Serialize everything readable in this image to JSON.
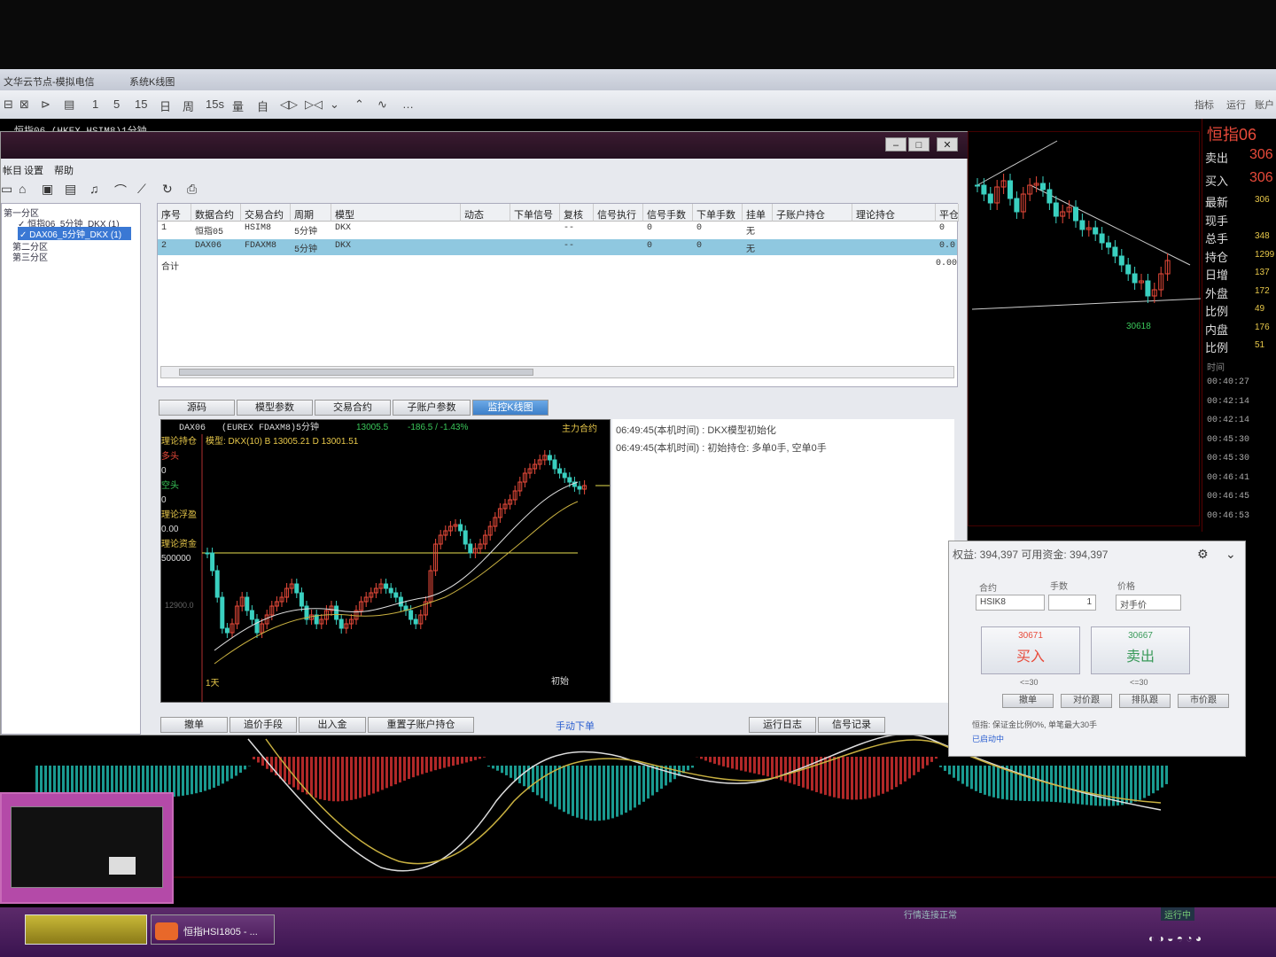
{
  "app": {
    "title": "文华云节点-模拟电信",
    "title2": "系统K线图",
    "toolbar": [
      "1",
      "5",
      "15",
      "日",
      "周",
      "15s",
      "量",
      "自"
    ],
    "toolbar_right": [
      "指标",
      "运行",
      "账户"
    ]
  },
  "main_chart": {
    "header": "恒指06   (HKEX HSIM8)1分钟"
  },
  "strategy_window": {
    "menu": [
      "帐目",
      "设置",
      "帮助"
    ],
    "tree": {
      "group1": "第一分区",
      "item1": "✓ 恒指06_5分钟_DKX (1)",
      "item2": "✓ DAX06_5分钟_DKX (1)",
      "group2": "第二分区",
      "group3": "第三分区"
    },
    "grid": {
      "headers": [
        "序号",
        "数据合约",
        "交易合约",
        "周期",
        "模型",
        "动态",
        "下单信号",
        "复核",
        "信号执行",
        "信号手数",
        "下单手数",
        "挂单",
        "子账户持仓",
        "理论持仓",
        "平仓"
      ],
      "rows": [
        [
          "1",
          "恒指05",
          "HSIM8",
          "5分钟",
          "DKX",
          "--",
          "0",
          "0",
          "无",
          "0"
        ],
        [
          "2",
          "DAX06",
          "FDAXM8",
          "5分钟",
          "DKX",
          "--",
          "0",
          "0",
          "无",
          "0.0"
        ]
      ],
      "total_label": "合计",
      "total_value": "0.00"
    },
    "tabs": [
      "源码",
      "模型参数",
      "交易合约",
      "子账户参数",
      "监控K线图"
    ],
    "mini_chart": {
      "symbol": "DAX06",
      "contract": "(EUREX FDAXM8)5分钟",
      "price": "13005.5",
      "change": "-186.5 / -1.43%",
      "main_label": "主力合约",
      "model_line": "模型: DKX(10)  B 13005.21   D 13001.51",
      "side_labels": [
        "理论持仓",
        "多头",
        "0",
        "空头",
        "0",
        "理论浮盈",
        "0.00",
        "理论资金",
        "500000"
      ],
      "price_label": "12900.0",
      "bottom_left": "1天",
      "bottom_right": "初始"
    },
    "log": [
      "06:49:45(本机时间) : DKX模型初始化",
      "06:49:45(本机时间) : 初始持仓: 多单0手, 空单0手"
    ],
    "bottom_buttons": [
      "撤单",
      "追价手段",
      "出入金",
      "重置子账户持仓"
    ],
    "manual_link": "手动下单",
    "bottom_right_buttons": [
      "运行日志",
      "信号记录"
    ]
  },
  "quote": {
    "title": "恒指06",
    "sell_label": "卖出",
    "sell_val": "306",
    "buy_label": "买入",
    "buy_val": "306",
    "rows": [
      {
        "label": "最新",
        "val": "306"
      },
      {
        "label": "现手",
        "val": ""
      },
      {
        "label": "总手",
        "val": "348"
      },
      {
        "label": "持仓",
        "val": "1299"
      },
      {
        "label": "日增",
        "val": "137"
      },
      {
        "label": "外盘",
        "val": "172"
      },
      {
        "label": "比例",
        "val": "49"
      },
      {
        "label": "内盘",
        "val": "176"
      },
      {
        "label": "比例",
        "val": "51"
      }
    ],
    "time_label": "时间",
    "times": [
      "00:40:27",
      "00:42:14",
      "00:42:14",
      "00:45:30",
      "00:45:30",
      "00:46:41",
      "00:46:45",
      "00:46:53"
    ],
    "right_chart_low": "30618"
  },
  "trade": {
    "equity": "权益: 394,397   可用资金: 394,397",
    "label_contract": "合约",
    "label_qty": "手数",
    "label_price": "价格",
    "contract_val": "HSIK8",
    "qty_val": "1",
    "price_val": "对手价",
    "buy_price": "30671",
    "buy_label": "买入",
    "sell_price": "30667",
    "sell_label": "卖出",
    "buy_sub": "<=30",
    "sell_sub": "<=30",
    "action_buttons": [
      "撤单",
      "对价跟",
      "排队跟",
      "市价跟"
    ],
    "note": "恒指: 保证金比例0%, 单笔最大30手",
    "link": "已启动中"
  },
  "taskbar": {
    "item1": "恒指HSI1805 - ...",
    "status": "运行中",
    "ticker": "行情连接正常"
  }
}
